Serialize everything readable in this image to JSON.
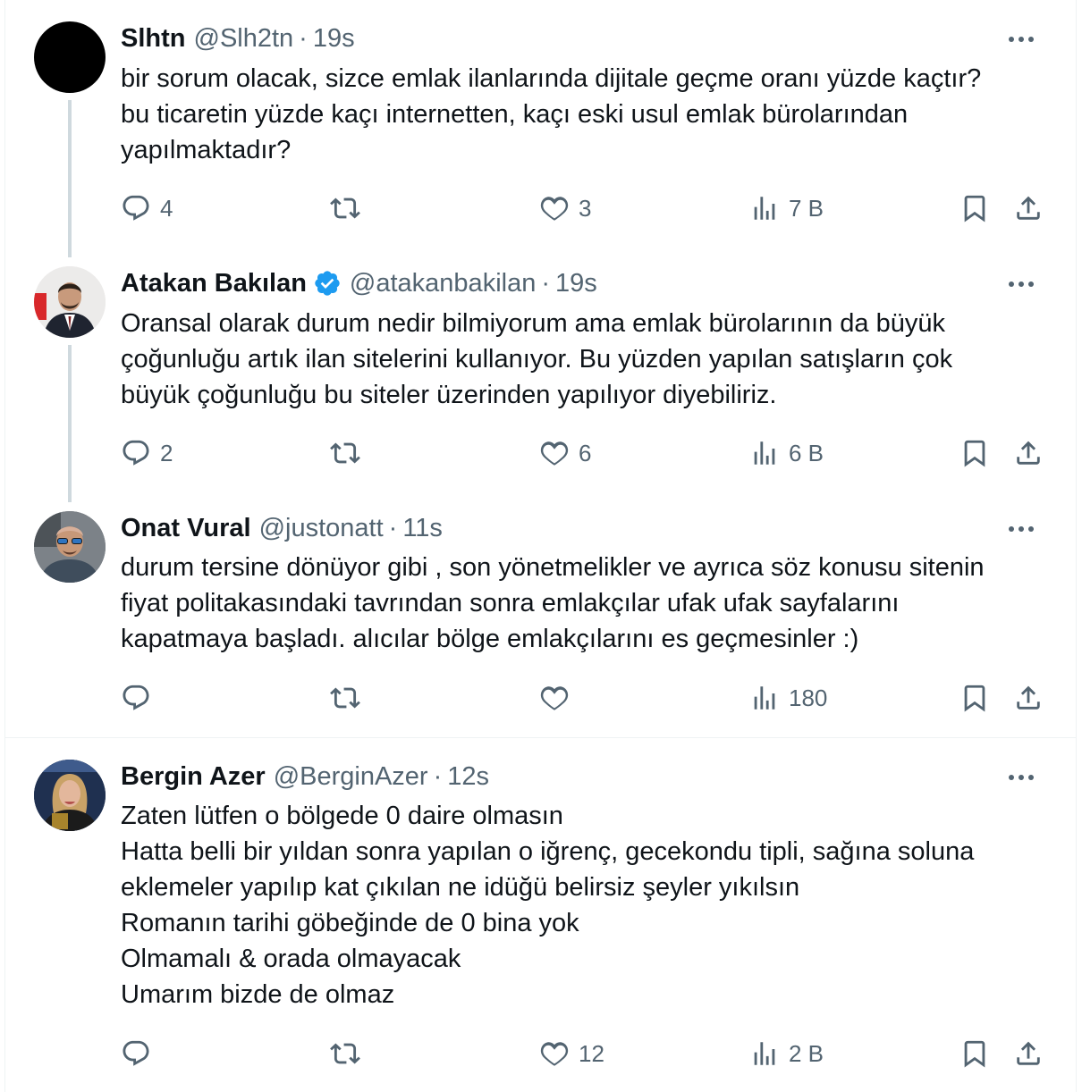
{
  "tweets": [
    {
      "name": "Slhtn",
      "handle": "@Slh2tn",
      "time": "19s",
      "verified": false,
      "lines": [
        "bir sorum olacak, sizce emlak ilanlarında dijitale geçme oranı yüzde kaçtır?",
        "bu ticaretin yüzde kaçı internetten, kaçı eski usul emlak bürolarından",
        "yapılmaktadır?"
      ],
      "replies": "4",
      "retweets": "",
      "likes": "3",
      "views": "7 B"
    },
    {
      "name": "Atakan Bakılan",
      "handle": "@atakanbakilan",
      "time": "19s",
      "verified": true,
      "lines": [
        "Oransal olarak durum nedir bilmiyorum ama emlak bürolarının da büyük",
        "çoğunluğu artık ilan sitelerini kullanıyor. Bu yüzden yapılan satışların çok",
        "büyük çoğunluğu bu siteler üzerinden yapılıyor diyebiliriz."
      ],
      "replies": "2",
      "retweets": "",
      "likes": "6",
      "views": "6 B"
    },
    {
      "name": "Onat Vural",
      "handle": "@justonatt",
      "time": "11s",
      "verified": false,
      "lines": [
        "durum tersine dönüyor gibi , son yönetmelikler ve  ayrıca söz konusu sitenin",
        "fiyat politakasındaki  tavrından sonra emlakçılar ufak ufak sayfalarını",
        "kapatmaya başladı. alıcılar bölge emlakçılarını es geçmesinler :)"
      ],
      "replies": "",
      "retweets": "",
      "likes": "",
      "views": "180"
    },
    {
      "name": "Bergin Azer",
      "handle": "@BerginAzer",
      "time": "12s",
      "verified": false,
      "lines": [
        "Zaten lütfen o bölgede 0 daire olmasın",
        "Hatta belli bir yıldan sonra yapılan o iğrenç, gecekondu tipli, sağına soluna",
        "eklemeler yapılıp kat çıkılan ne idüğü belirsiz şeyler yıkılsın",
        "Romanın tarihi göbeğinde de 0 bina yok",
        "Olmamalı & orada olmayacak",
        "Umarım bizde de olmaz"
      ],
      "replies": "",
      "retweets": "",
      "likes": "12",
      "views": "2 B"
    }
  ],
  "colors": {
    "text": "#0f1419",
    "muted": "#536471",
    "thread": "#cfd9de",
    "verified": "#1d9bf0"
  },
  "icons": [
    "more-icon",
    "reply-icon",
    "retweet-icon",
    "like-icon",
    "views-icon",
    "bookmark-icon",
    "share-icon",
    "verified-badge-icon"
  ]
}
